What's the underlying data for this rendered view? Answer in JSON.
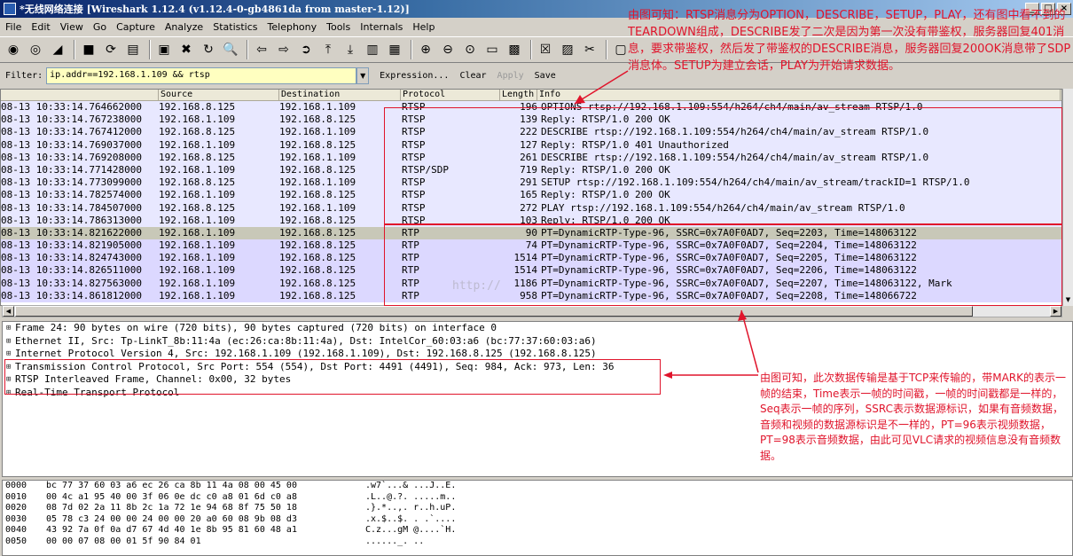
{
  "window": {
    "title": "*无线网络连接   [Wireshark 1.12.4  (v1.12.4-0-gb4861da from master-1.12)]",
    "buttons": [
      "_",
      "□",
      "×"
    ]
  },
  "menu": [
    "File",
    "Edit",
    "View",
    "Go",
    "Capture",
    "Analyze",
    "Statistics",
    "Telephony",
    "Tools",
    "Internals",
    "Help"
  ],
  "toolbar_icons": [
    {
      "name": "interfaces-icon",
      "glyph": "◉"
    },
    {
      "name": "options-icon",
      "glyph": "◎"
    },
    {
      "name": "start-capture-icon",
      "glyph": "◢"
    },
    {
      "name": "stop-capture-icon",
      "glyph": "■"
    },
    {
      "name": "restart-capture-icon",
      "glyph": "⟳"
    },
    {
      "name": "open-icon",
      "glyph": "▤"
    },
    {
      "name": "save-icon",
      "glyph": "▣"
    },
    {
      "name": "close-icon",
      "glyph": "✖"
    },
    {
      "name": "reload-icon",
      "glyph": "↻"
    },
    {
      "name": "find-icon",
      "glyph": "🔍"
    },
    {
      "name": "back-icon",
      "glyph": "⇦"
    },
    {
      "name": "forward-icon",
      "glyph": "⇨"
    },
    {
      "name": "goto-icon",
      "glyph": "➲"
    },
    {
      "name": "first-packet-icon",
      "glyph": "⤒"
    },
    {
      "name": "last-packet-icon",
      "glyph": "⤓"
    },
    {
      "name": "colorize-icon",
      "glyph": "▥"
    },
    {
      "name": "autoscroll-icon",
      "glyph": "▦"
    },
    {
      "name": "zoom-in-icon",
      "glyph": "⊕"
    },
    {
      "name": "zoom-out-icon",
      "glyph": "⊖"
    },
    {
      "name": "zoom-normal-icon",
      "glyph": "⊙"
    },
    {
      "name": "resize-columns-icon",
      "glyph": "▭"
    },
    {
      "name": "capture-filters-icon",
      "glyph": "▩"
    },
    {
      "name": "display-filters-icon",
      "glyph": "☒"
    },
    {
      "name": "coloring-rules-icon",
      "glyph": "▨"
    },
    {
      "name": "preferences-icon",
      "glyph": "✂"
    },
    {
      "name": "help-icon",
      "glyph": "▢"
    }
  ],
  "filter": {
    "label": "Filter:",
    "value": "ip.addr==192.168.1.109 && rtsp",
    "expression": "Expression...",
    "clear": "Clear",
    "apply": "Apply",
    "save": "Save"
  },
  "columns": [
    "",
    "Source",
    "Destination",
    "Protocol",
    "Length",
    "Info"
  ],
  "packets": [
    {
      "time": "08-13 10:33:14.764662000",
      "src": "192.168.8.125",
      "dst": "192.168.1.109",
      "proto": "RTSP",
      "len": "196",
      "info": "OPTIONS rtsp://192.168.1.109:554/h264/ch4/main/av_stream RTSP/1.0",
      "kind": "rtsp"
    },
    {
      "time": "08-13 10:33:14.767238000",
      "src": "192.168.1.109",
      "dst": "192.168.8.125",
      "proto": "RTSP",
      "len": "139",
      "info": "Reply: RTSP/1.0 200 OK",
      "kind": "rtsp"
    },
    {
      "time": "08-13 10:33:14.767412000",
      "src": "192.168.8.125",
      "dst": "192.168.1.109",
      "proto": "RTSP",
      "len": "222",
      "info": "DESCRIBE rtsp://192.168.1.109:554/h264/ch4/main/av_stream RTSP/1.0",
      "kind": "rtsp"
    },
    {
      "time": "08-13 10:33:14.769037000",
      "src": "192.168.1.109",
      "dst": "192.168.8.125",
      "proto": "RTSP",
      "len": "127",
      "info": "Reply: RTSP/1.0 401 Unauthorized",
      "kind": "rtsp"
    },
    {
      "time": "08-13 10:33:14.769208000",
      "src": "192.168.8.125",
      "dst": "192.168.1.109",
      "proto": "RTSP",
      "len": "261",
      "info": "DESCRIBE rtsp://192.168.1.109:554/h264/ch4/main/av_stream RTSP/1.0",
      "kind": "rtsp"
    },
    {
      "time": "08-13 10:33:14.771428000",
      "src": "192.168.1.109",
      "dst": "192.168.8.125",
      "proto": "RTSP/SDP",
      "len": "719",
      "info": "Reply: RTSP/1.0 200 OK",
      "kind": "rtsp"
    },
    {
      "time": "08-13 10:33:14.773099000",
      "src": "192.168.8.125",
      "dst": "192.168.1.109",
      "proto": "RTSP",
      "len": "291",
      "info": "SETUP rtsp://192.168.1.109:554/h264/ch4/main/av_stream/trackID=1 RTSP/1.0",
      "kind": "rtsp"
    },
    {
      "time": "08-13 10:33:14.782574000",
      "src": "192.168.1.109",
      "dst": "192.168.8.125",
      "proto": "RTSP",
      "len": "165",
      "info": "Reply: RTSP/1.0 200 OK",
      "kind": "rtsp"
    },
    {
      "time": "08-13 10:33:14.784507000",
      "src": "192.168.8.125",
      "dst": "192.168.1.109",
      "proto": "RTSP",
      "len": "272",
      "info": "PLAY rtsp://192.168.1.109:554/h264/ch4/main/av_stream RTSP/1.0",
      "kind": "rtsp"
    },
    {
      "time": "08-13 10:33:14.786313000",
      "src": "192.168.1.109",
      "dst": "192.168.8.125",
      "proto": "RTSP",
      "len": "103",
      "info": "Reply: RTSP/1.0 200 OK",
      "kind": "rtsp"
    },
    {
      "time": "08-13 10:33:14.821622000",
      "src": "192.168.1.109",
      "dst": "192.168.8.125",
      "proto": "RTP",
      "len": "90",
      "info": "PT=DynamicRTP-Type-96, SSRC=0x7A0F0AD7, Seq=2203, Time=148063122",
      "kind": "selected"
    },
    {
      "time": "08-13 10:33:14.821905000",
      "src": "192.168.1.109",
      "dst": "192.168.8.125",
      "proto": "RTP",
      "len": "74",
      "info": "PT=DynamicRTP-Type-96, SSRC=0x7A0F0AD7, Seq=2204, Time=148063122",
      "kind": "rtp"
    },
    {
      "time": "08-13 10:33:14.824743000",
      "src": "192.168.1.109",
      "dst": "192.168.8.125",
      "proto": "RTP",
      "len": "1514",
      "info": "PT=DynamicRTP-Type-96, SSRC=0x7A0F0AD7, Seq=2205, Time=148063122",
      "kind": "rtp"
    },
    {
      "time": "08-13 10:33:14.826511000",
      "src": "192.168.1.109",
      "dst": "192.168.8.125",
      "proto": "RTP",
      "len": "1514",
      "info": "PT=DynamicRTP-Type-96, SSRC=0x7A0F0AD7, Seq=2206, Time=148063122",
      "kind": "rtp"
    },
    {
      "time": "08-13 10:33:14.827563000",
      "src": "192.168.1.109",
      "dst": "192.168.8.125",
      "proto": "RTP",
      "len": "1186",
      "info": "PT=DynamicRTP-Type-96, SSRC=0x7A0F0AD7, Seq=2207, Time=148063122, Mark",
      "kind": "rtp"
    },
    {
      "time": "08-13 10:33:14.861812000",
      "src": "192.168.1.109",
      "dst": "192.168.8.125",
      "proto": "RTP",
      "len": "958",
      "info": "PT=DynamicRTP-Type-96, SSRC=0x7A0F0AD7, Seq=2208, Time=148066722",
      "kind": "rtp"
    }
  ],
  "details": [
    "Frame 24: 90 bytes on wire (720 bits), 90 bytes captured (720 bits) on interface 0",
    "Ethernet II, Src: Tp-LinkT_8b:11:4a (ec:26:ca:8b:11:4a), Dst: IntelCor_60:03:a6 (bc:77:37:60:03:a6)",
    "Internet Protocol Version 4, Src: 192.168.1.109 (192.168.1.109), Dst: 192.168.8.125 (192.168.8.125)",
    "Transmission Control Protocol, Src Port: 554 (554), Dst Port: 4491 (4491), Seq: 984, Ack: 973, Len: 36",
    "RTSP Interleaved Frame, Channel: 0x00, 32 bytes",
    "Real-Time Transport Protocol"
  ],
  "bytes": [
    {
      "off": "0000",
      "hex": "bc 77 37 60 03 a6 ec 26  ca 8b 11 4a 08 00 45 00",
      "ascii": ".w7`...& ...J..E."
    },
    {
      "off": "0010",
      "hex": "00 4c a1 95 40 00 3f 06  0e dc c0 a8 01 6d c0 a8",
      "ascii": ".L..@.?. .....m.."
    },
    {
      "off": "0020",
      "hex": "08 7d 02 2a 11 8b 2c 1a  72 1e 94 68 8f 75 50 18",
      "ascii": ".}.*..,. r..h.uP."
    },
    {
      "off": "0030",
      "hex": "05 78 c3 24 00 00 24 00  00 20 a0 60 08 9b 08 d3",
      "ascii": ".x.$..$. . .`...."
    },
    {
      "off": "0040",
      "hex": "43 92 7a 0f 0a d7 67 4d  40 1e 8b 95 81 60 48 a1",
      "ascii": "C.z...gM @....`H."
    },
    {
      "off": "0050",
      "hex": "00 00 07 08 00 01 5f 90  84 01",
      "ascii": "......_. .."
    }
  ],
  "annotations": {
    "top": "由图可知：RTSP消息分为OPTION，DESCRIBE，SETUP，PLAY，还有图中看不到的TEARDOWN组成，DESCRIBE发了二次是因为第一次没有带鉴权，服务器回复401消息，要求带鉴权，然后发了带鉴权的DESCRIBE消息，服务器回复200OK消息带了SDP消息体。SETUP为建立会话，PLAY为开始请求数据。",
    "bottom": "由图可知，此次数据传输是基于TCP来传输的，带MARK的表示一帧的结束，Time表示一帧的时间戳，一帧的时间戳都是一样的，Seq表示一帧的序列，SSRC表示数据源标识，如果有音频数据，音频和视频的数据源标识是不一样的，PT=96表示视频数据，PT=98表示音频数据，由此可见VLC请求的视频信息没有音频数据。",
    "color": "#e0142b"
  },
  "watermark": "http://"
}
